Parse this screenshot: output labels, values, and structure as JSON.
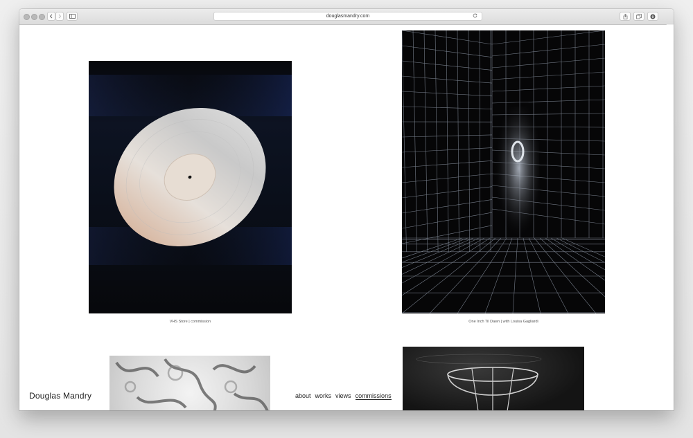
{
  "browser": {
    "url": "douglasmandry.com",
    "back_icon": "chevron-left-icon",
    "forward_icon": "chevron-right-icon",
    "sidebar_icon": "sidebar-icon",
    "reload_icon": "reload-icon",
    "share_icon": "share-icon",
    "tabs_icon": "tabs-icon",
    "downloads_icon": "download-icon"
  },
  "gallery": {
    "items": [
      {
        "caption": "VHS Store | commission"
      },
      {
        "caption": "One Inch Til Dawn | with Louisa Gagliardi"
      },
      {
        "caption": ""
      },
      {
        "caption": ""
      }
    ]
  },
  "site": {
    "name": "Douglas Mandry",
    "nav": [
      {
        "label": "about",
        "active": false
      },
      {
        "label": "works",
        "active": false
      },
      {
        "label": "views",
        "active": false
      },
      {
        "label": "commissions",
        "active": true
      }
    ]
  },
  "colors": {
    "page_bg": "#ffffff",
    "text": "#222222",
    "caption": "#555555"
  }
}
